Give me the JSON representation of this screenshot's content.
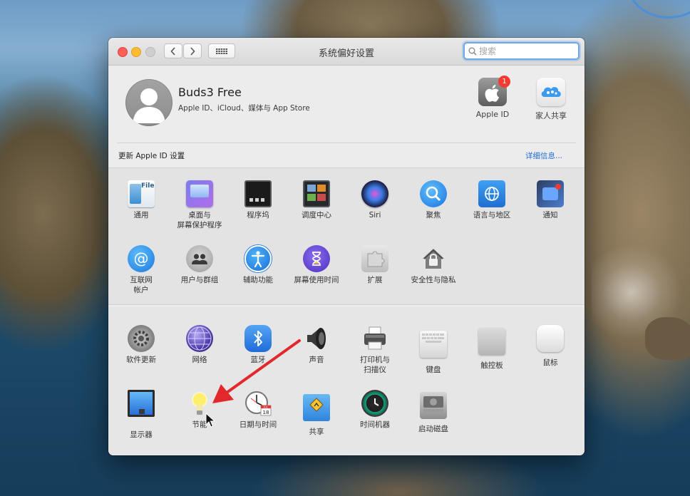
{
  "window": {
    "title": "系统偏好设置",
    "search_placeholder": "搜索"
  },
  "account": {
    "name": "Buds3 Free",
    "subtitle": "Apple ID、iCloud、媒体与 App Store",
    "apple_id_label": "Apple ID",
    "apple_id_badge": "1",
    "family_label": "家人共享",
    "notice": "更新 Apple ID 设置",
    "details_link": "详细信息..."
  },
  "row1": [
    {
      "label": "通用"
    },
    {
      "label": "桌面与\n屏幕保护程序"
    },
    {
      "label": "程序坞"
    },
    {
      "label": "调度中心"
    },
    {
      "label": "Siri"
    },
    {
      "label": "聚焦"
    },
    {
      "label": "语言与地区"
    },
    {
      "label": "通知"
    }
  ],
  "row2": [
    {
      "label": "互联网\n帐户"
    },
    {
      "label": "用户与群组"
    },
    {
      "label": "辅助功能"
    },
    {
      "label": "屏幕使用时间"
    },
    {
      "label": "扩展"
    },
    {
      "label": "安全性与隐私"
    }
  ],
  "row3": [
    {
      "label": "软件更新"
    },
    {
      "label": "网络"
    },
    {
      "label": "蓝牙"
    },
    {
      "label": "声音"
    },
    {
      "label": "打印机与\n扫描仪"
    },
    {
      "label": "键盘"
    },
    {
      "label": "触控板"
    },
    {
      "label": "鼠标"
    }
  ],
  "row4": [
    {
      "label": "显示器"
    },
    {
      "label": "节能"
    },
    {
      "label": "日期与时间"
    },
    {
      "label": "共享"
    },
    {
      "label": "时间机器"
    },
    {
      "label": "启动磁盘"
    }
  ],
  "datetime_icon": {
    "month": "JUL",
    "day": "18"
  },
  "colors": {
    "accent": "#1f6dd6",
    "annotation_arrow": "#e3282c",
    "badge": "#f33a30"
  }
}
